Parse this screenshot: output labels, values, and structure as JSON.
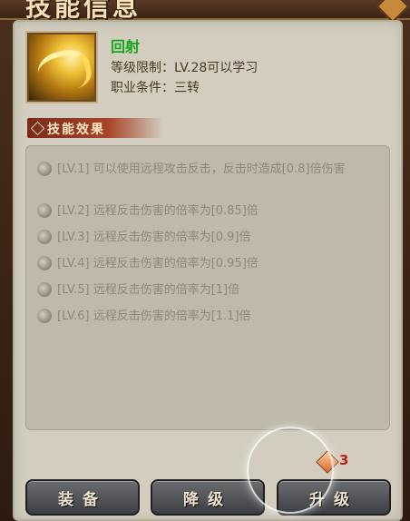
{
  "window": {
    "title": "技能信息"
  },
  "skill": {
    "name": "回射",
    "level_req": "等级限制：LV.28可以学习",
    "job_req": "职业条件：三转",
    "icon": "skill-arrow-swirl-icon"
  },
  "effects_header": "技能效果",
  "effects": [
    {
      "text": "[LV.1] 可以使用远程攻击反击，反击时造成[0.8]倍伤害"
    },
    {
      "text": "[LV.2] 远程反击伤害的倍率为[0.85]倍"
    },
    {
      "text": "[LV.3] 远程反击伤害的倍率为[0.9]倍"
    },
    {
      "text": "[LV.4] 远程反击伤害的倍率为[0.95]倍"
    },
    {
      "text": "[LV.5] 远程反击伤害的倍率为[1]倍"
    },
    {
      "text": "[LV.6] 远程反击伤害的倍率为[1.1]倍"
    }
  ],
  "cost": {
    "value": "3",
    "icon": "skill-point-icon"
  },
  "buttons": {
    "equip": "装备",
    "downgrade": "降级",
    "upgrade": "升级"
  },
  "colors": {
    "skill_name": "#13a81b",
    "cost": "#c0201a",
    "ribbon": "#a8452a"
  }
}
